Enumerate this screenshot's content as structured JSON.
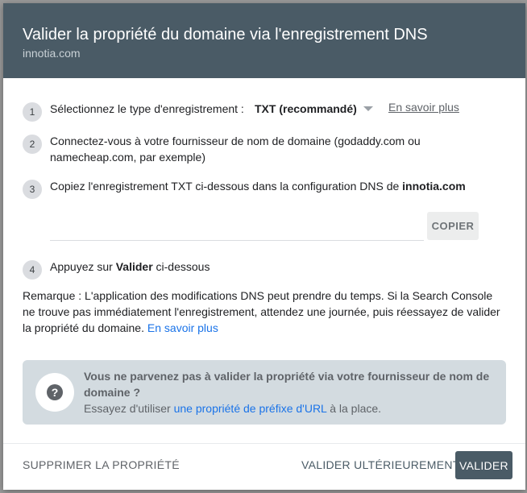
{
  "dialog": {
    "title": "Valider la propriété du domaine via l'enregistrement DNS",
    "domain": "innotia.com"
  },
  "steps": [
    {
      "number": "1",
      "label": "Sélectionnez le type d'enregistrement :",
      "record_type": "TXT (recommandé)",
      "learn_more": "En savoir plus"
    },
    {
      "number": "2",
      "text": "Connectez-vous à votre fournisseur de nom de domaine (godaddy.com ou namecheap.com, par exemple)"
    },
    {
      "number": "3",
      "text": "Copiez l'enregistrement TXT ci-dessous dans la configuration DNS de",
      "domain": "innotia.com",
      "txt_value": "",
      "copy_label": "COPIER"
    },
    {
      "number": "4",
      "text_before": "Appuyez sur",
      "bold": "Valider",
      "text_after": "ci-dessous"
    }
  ],
  "note": {
    "text": "Remarque : L'application des modifications DNS peut prendre du temps. Si la Search Console ne trouve pas immédiatement l'enregistrement, attendez une journée, puis réessayez de valider la propriété du domaine.",
    "link": "En savoir plus"
  },
  "help": {
    "icon": "question-circle-icon",
    "title": "Vous ne parvenez pas à valider la propriété via votre fournisseur de nom de domaine ?",
    "body_before": "Essayez d'utiliser",
    "link": "une propriété de préfixe d'URL",
    "body_after": "à la place."
  },
  "footer": {
    "remove_label": "SUPPRIMER LA PROPRIÉTÉ",
    "later_label": "VALIDER ULTÉRIEUREMENT",
    "validate_label": "VALIDER"
  },
  "colors": {
    "header_bg": "#4a5b66",
    "link": "#1a73e8",
    "help_box_bg": "#d3dbe0",
    "validate_button_bg": "#4a5b66"
  }
}
